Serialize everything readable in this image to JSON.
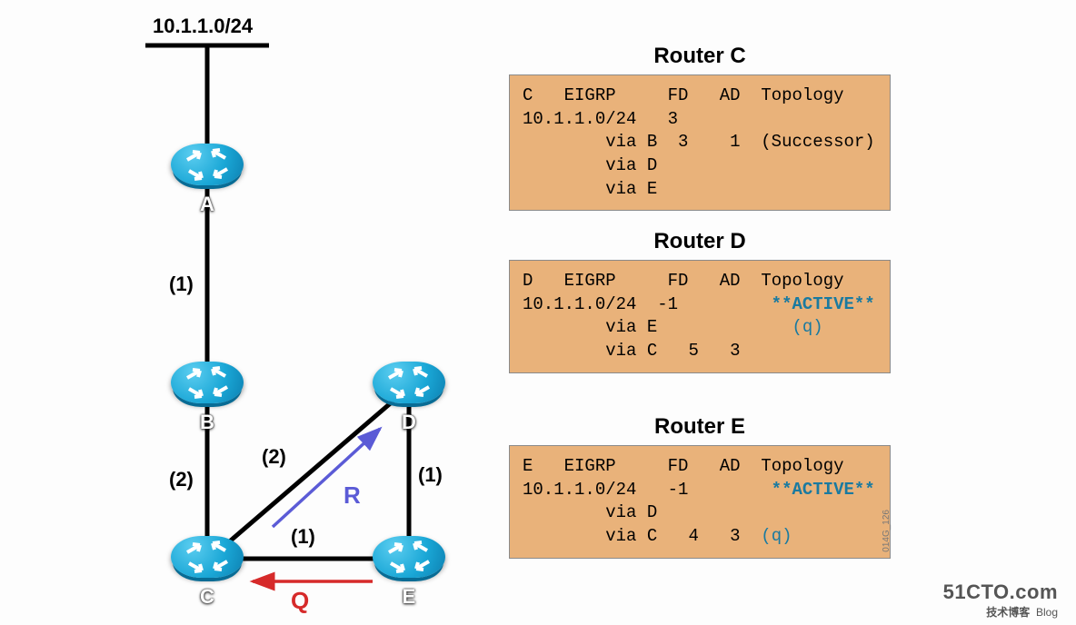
{
  "network": {
    "prefix": "10.1.1.0/24"
  },
  "routers": {
    "A": {
      "label": "A"
    },
    "B": {
      "label": "B"
    },
    "C": {
      "label": "C"
    },
    "D": {
      "label": "D"
    },
    "E": {
      "label": "E"
    }
  },
  "links": [
    {
      "from": "A",
      "to": "B",
      "cost": "(1)"
    },
    {
      "from": "B",
      "to": "C",
      "cost": "(2)"
    },
    {
      "from": "C",
      "to": "D",
      "cost": "(2)"
    },
    {
      "from": "C",
      "to": "E",
      "cost": "(1)"
    },
    {
      "from": "D",
      "to": "E",
      "cost": "(1)"
    }
  ],
  "flows": {
    "R": {
      "label": "R",
      "from": "C",
      "to": "D",
      "color": "#5b5bd6"
    },
    "Q": {
      "label": "Q",
      "from": "E",
      "to": "C",
      "color": "#d62a2a"
    }
  },
  "tables": {
    "C": {
      "title": "Router C",
      "header": {
        "id": "C",
        "proto": "EIGRP",
        "cols": [
          "FD",
          "AD",
          "Topology"
        ]
      },
      "prefix": "10.1.1.0/24",
      "prefix_fd": "3",
      "rows": [
        {
          "via": "B",
          "fd": "3",
          "ad": "1",
          "topo": "(Successor)"
        },
        {
          "via": "D",
          "fd": "",
          "ad": "",
          "topo": ""
        },
        {
          "via": "E",
          "fd": "",
          "ad": "",
          "topo": ""
        }
      ]
    },
    "D": {
      "title": "Router D",
      "header": {
        "id": "D",
        "proto": "EIGRP",
        "cols": [
          "FD",
          "AD",
          "Topology"
        ]
      },
      "prefix": "10.1.1.0/24",
      "prefix_fd": "-1",
      "active": "**ACTIVE**",
      "rows": [
        {
          "via": "E",
          "fd": "",
          "ad": "",
          "topo_q": "(q)"
        },
        {
          "via": "C",
          "fd": "5",
          "ad": "3",
          "topo": ""
        }
      ]
    },
    "E": {
      "title": "Router E",
      "header": {
        "id": "E",
        "proto": "EIGRP",
        "cols": [
          "FD",
          "AD",
          "Topology"
        ]
      },
      "prefix": "10.1.1.0/24",
      "prefix_fd": "-1",
      "active": "**ACTIVE**",
      "rows": [
        {
          "via": "D",
          "fd": "",
          "ad": "",
          "topo": ""
        },
        {
          "via": "C",
          "fd": "4",
          "ad": "3",
          "topo_q": "(q)"
        }
      ]
    }
  },
  "watermark": {
    "site": "51CTO.com",
    "tagline": "技术博客",
    "tag2": "Blog"
  },
  "sidecode": "014G_126"
}
